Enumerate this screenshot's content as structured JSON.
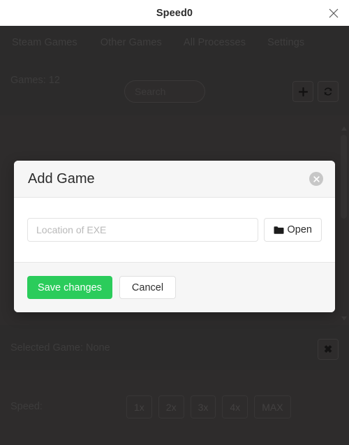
{
  "window": {
    "title": "Speed0",
    "close_icon": "close-icon"
  },
  "nav": {
    "tabs": [
      {
        "label": "Steam Games"
      },
      {
        "label": "Other Games"
      },
      {
        "label": "All Processes"
      },
      {
        "label": "Settings"
      }
    ]
  },
  "toolbar": {
    "games_count_label": "Games: 12",
    "search_placeholder": "Search",
    "add_icon": "plus-icon",
    "refresh_icon": "refresh-icon"
  },
  "selected": {
    "label": "Selected Game: None",
    "clear_label": "✖"
  },
  "speed": {
    "label": "Speed:",
    "options": [
      {
        "label": "1x"
      },
      {
        "label": "2x"
      },
      {
        "label": "3x"
      },
      {
        "label": "4x"
      },
      {
        "label": "MAX"
      }
    ]
  },
  "modal": {
    "title": "Add Game",
    "close_icon": "close-circle-icon",
    "input_placeholder": "Location of EXE",
    "input_value": "",
    "open_label": "Open",
    "open_icon": "folder-icon",
    "save_label": "Save changes",
    "cancel_label": "Cancel"
  },
  "colors": {
    "accent_green": "#2bcc5b",
    "window_dark": "#2e2c2c",
    "nav_dark": "#2c2b2b",
    "modal_header": "#f6f6f6",
    "titlebar": "#ffffff"
  }
}
